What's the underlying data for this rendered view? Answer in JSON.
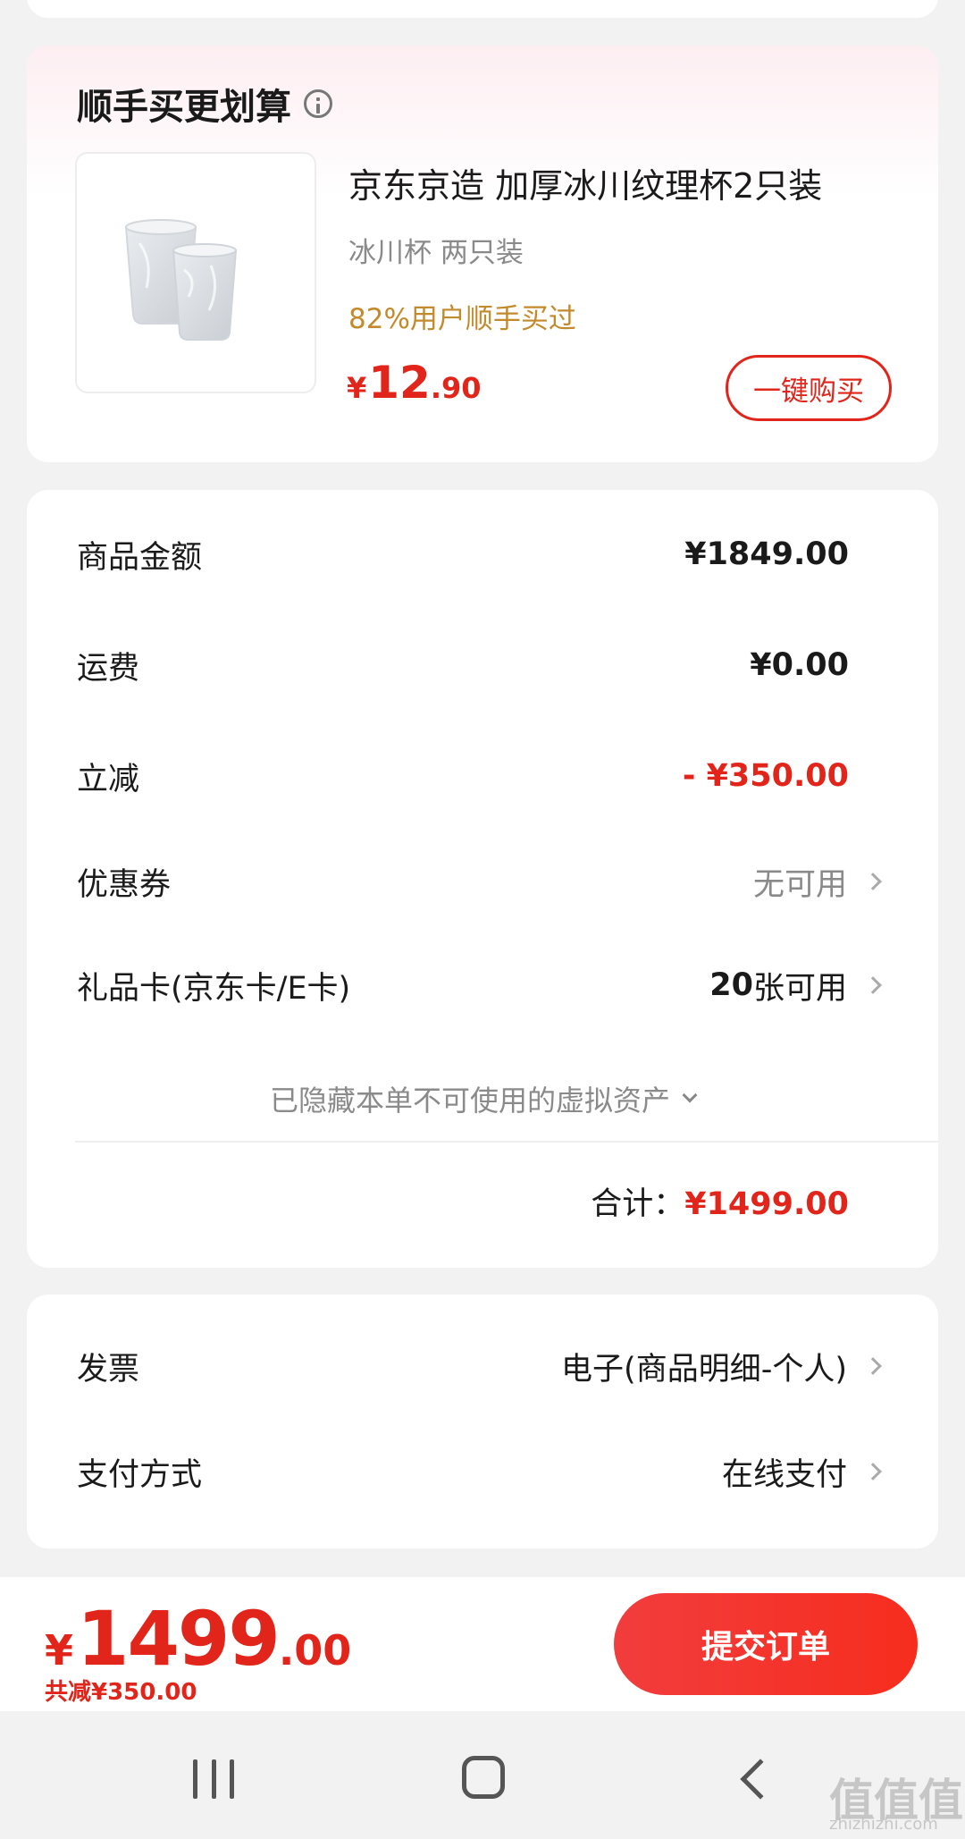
{
  "combo": {
    "title": "顺手买更划算",
    "product_name": "京东京造 加厚冰川纹理杯2只装",
    "product_spec": "冰川杯 两只装",
    "social_hint": "82%用户顺手买过",
    "price_symbol": "¥",
    "price_int": "12",
    "price_dec": ".90",
    "buy_label": "一键购买"
  },
  "summary": {
    "rows": [
      {
        "label": "商品金额",
        "value": "¥1849.00"
      },
      {
        "label": "运费",
        "value": "¥0.00"
      },
      {
        "label": "立减",
        "value": "- ¥350.00"
      },
      {
        "label": "优惠券",
        "value": "无可用"
      },
      {
        "label": "礼品卡(京东卡/E卡)",
        "value_num": "20",
        "value_text": "张可用"
      }
    ],
    "hidden_note": "已隐藏本单不可使用的虚拟资产",
    "total_label": "合计：",
    "total_value": "¥1499.00"
  },
  "invoice": {
    "rows": [
      {
        "label": "发票",
        "value": "电子(商品明细-个人)"
      },
      {
        "label": "支付方式",
        "value": "在线支付"
      }
    ]
  },
  "checkout": {
    "price_symbol": "¥",
    "price_int": "1499",
    "price_dec": ".00",
    "saved": "共减¥350.00",
    "submit_label": "提交订单"
  },
  "watermark": {
    "main": "值值值",
    "sub": "zhizhizhi.com"
  },
  "colors": {
    "accent": "#e1251b",
    "hint": "#c38a2c",
    "muted": "#8a8a8a"
  }
}
